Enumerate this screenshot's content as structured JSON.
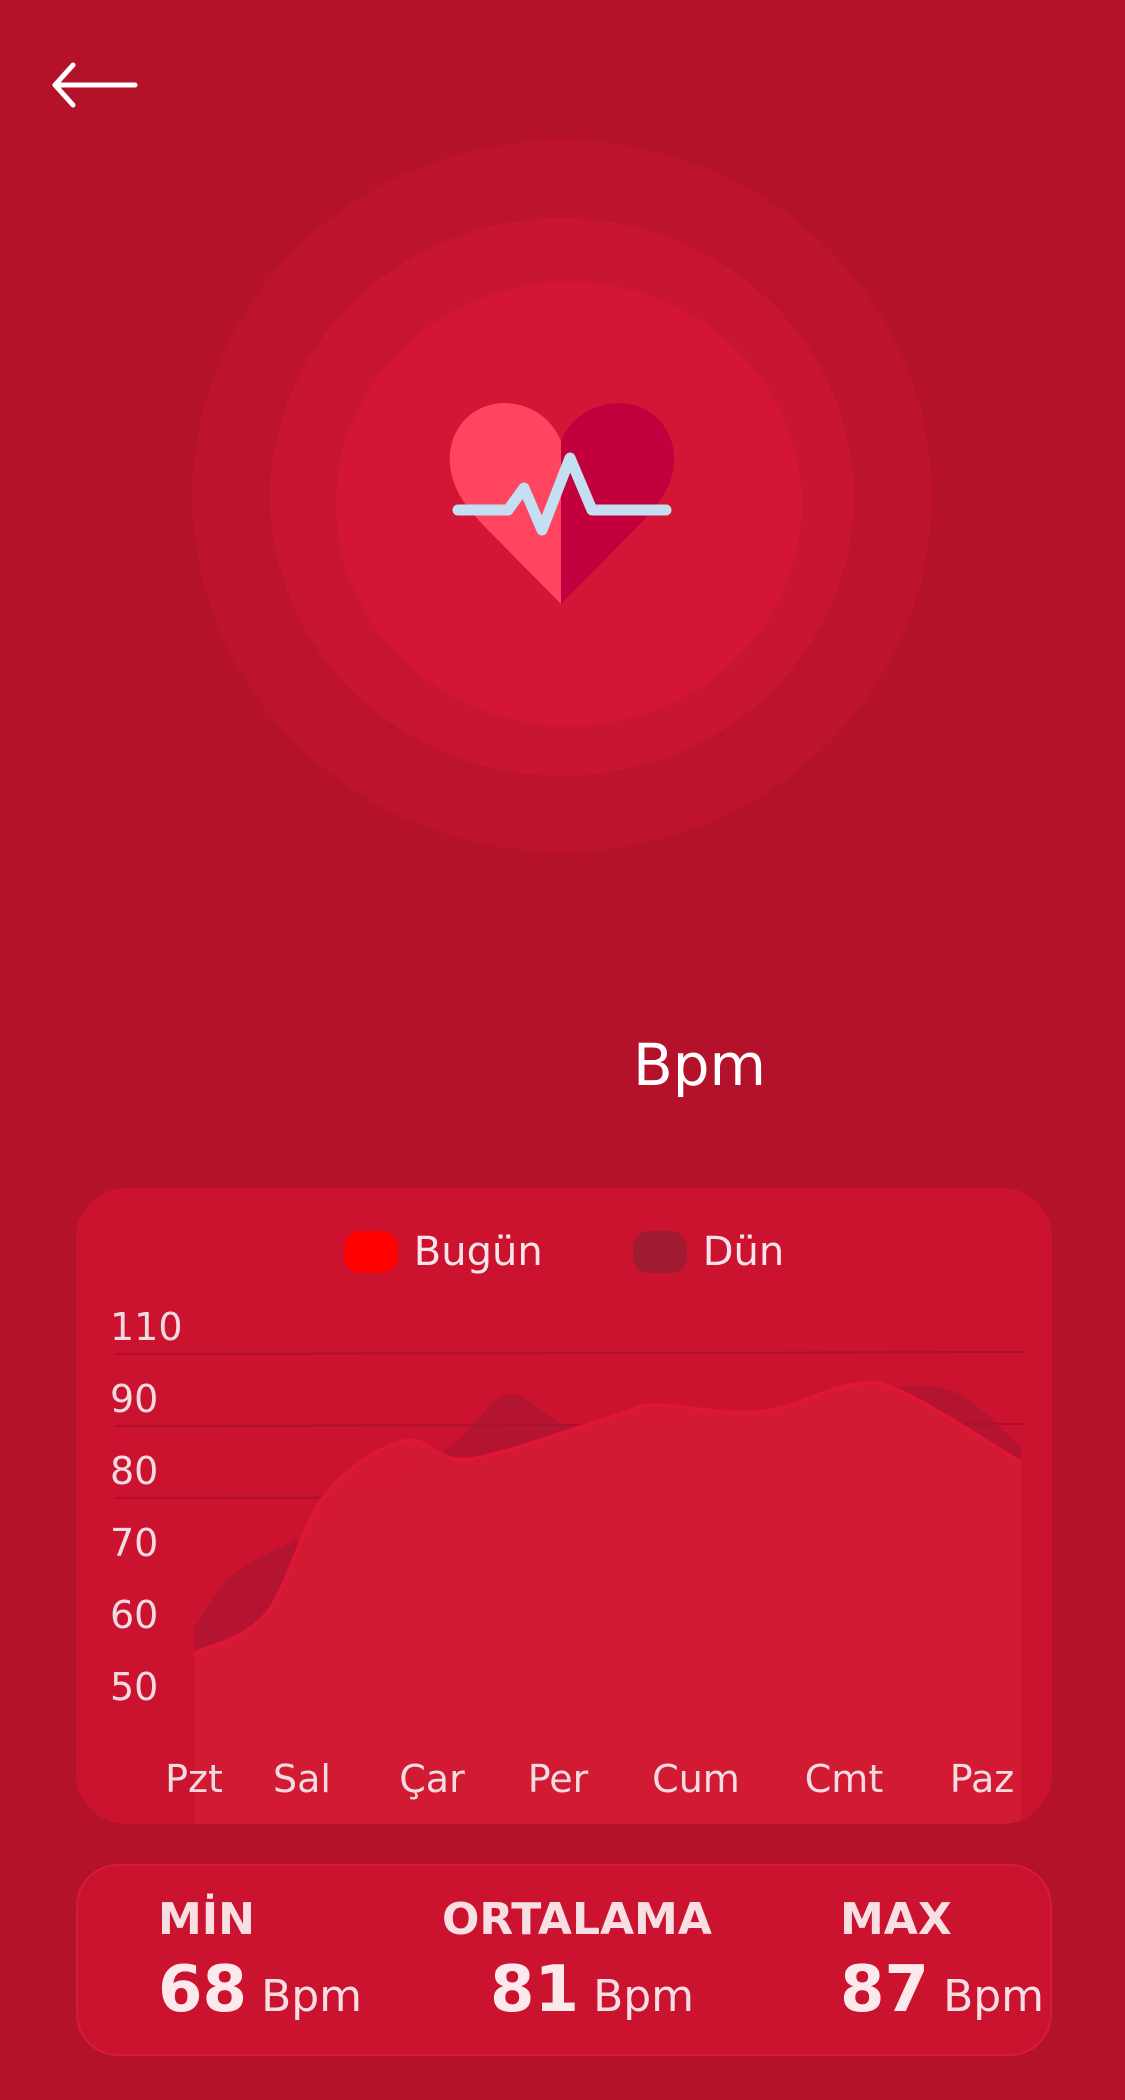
{
  "header": {
    "back_icon": "arrow-left-icon"
  },
  "hero": {
    "icon": "heart-pulse-icon",
    "bpm_value": "",
    "bpm_unit": "Bpm"
  },
  "legend": [
    {
      "label": "Bugün",
      "color": "#ff0000"
    },
    {
      "label": "Dün",
      "color": "#a01a30"
    }
  ],
  "chart_data": {
    "type": "area",
    "categories": [
      "Pzt",
      "Sal",
      "Çar",
      "Per",
      "Cum",
      "Cmt",
      "Paz"
    ],
    "y_ticks": [
      110,
      90,
      80,
      70,
      60,
      50
    ],
    "gridlines": [
      110,
      90,
      80
    ],
    "series": [
      {
        "name": "Bugün",
        "color": "#ff0000",
        "x": [
          0,
          0.55,
          1,
          1.6,
          2.1,
          3.2,
          3.5,
          4.3,
          5,
          5.4,
          6.3
        ],
        "values": [
          54.5,
          60,
          76.5,
          84,
          81.5,
          87.5,
          89,
          88,
          93.5,
          91.5,
          81
        ]
      },
      {
        "name": "Dün",
        "color": "#a01a30",
        "x": [
          0,
          0.3,
          0.8,
          1.4,
          2,
          2.4,
          2.9,
          4,
          5.2,
          5.8,
          6.3
        ],
        "values": [
          58,
          65.5,
          70.5,
          76,
          84,
          91,
          86,
          84,
          92,
          91.5,
          83
        ]
      }
    ]
  },
  "stats": [
    {
      "label": "MİN",
      "value": "68",
      "unit": "Bpm"
    },
    {
      "label": "ORTALAMA",
      "value": "81",
      "unit": "Bpm"
    },
    {
      "label": "MAX",
      "value": "87",
      "unit": "Bpm"
    }
  ]
}
